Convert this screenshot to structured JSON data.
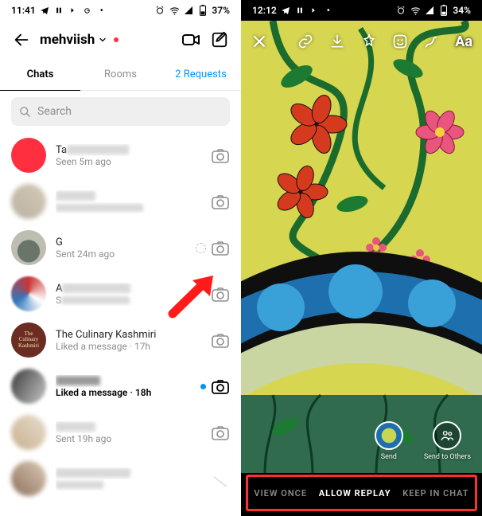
{
  "left": {
    "status": {
      "time": "11:41",
      "battery": "37%"
    },
    "username": "mehviish",
    "tabs": {
      "chats": "Chats",
      "rooms": "Rooms",
      "requests": "2 Requests"
    },
    "search_placeholder": "Search",
    "rows": [
      {
        "name_prefix": "Ta",
        "sub": "Seen 5m ago"
      },
      {
        "name_prefix": "",
        "sub": ""
      },
      {
        "name_prefix": "G",
        "sub": "Sent 24m ago"
      },
      {
        "name_prefix": "A",
        "sub": "S"
      },
      {
        "name_prefix": "The Culinary Kashmiri",
        "sub": "Liked a message · 17h"
      },
      {
        "name_prefix": "",
        "sub": "Liked a message · 18h"
      },
      {
        "name_prefix": "",
        "sub": "Sent 19h ago"
      },
      {
        "name_prefix": "",
        "sub": ""
      }
    ]
  },
  "right": {
    "status": {
      "time": "12:12",
      "battery": "34%"
    },
    "text_label": "Aa",
    "send": {
      "primary": "Send",
      "others": "Send to Others"
    },
    "modes": {
      "once": "VIEW ONCE",
      "replay": "ALLOW REPLAY",
      "keep": "KEEP IN CHAT"
    }
  }
}
